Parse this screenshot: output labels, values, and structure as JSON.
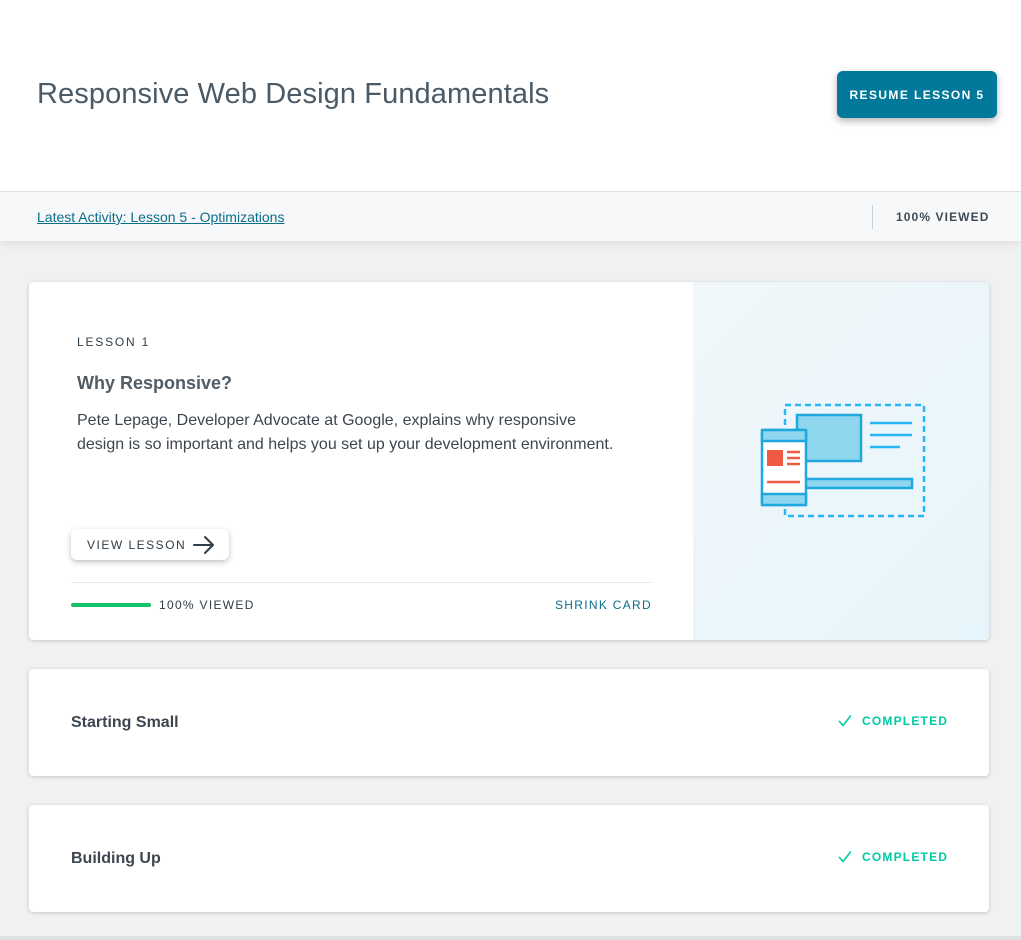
{
  "course": {
    "title": "Responsive Web Design Fundamentals",
    "resume_label": "RESUME LESSON 5"
  },
  "activity": {
    "latest_link": "Latest Activity: Lesson 5 - Optimizations",
    "viewed": "100% VIEWED"
  },
  "lessons": [
    {
      "kicker": "LESSON 1",
      "title": "Why Responsive?",
      "description": "Pete Lepage, Developer Advocate at Google, explains why responsive design is so important and helps you set up your development environment.",
      "view_label": "VIEW LESSON",
      "progress": 1.0,
      "progress_label": "100% VIEWED",
      "shrink_label": "SHRINK CARD",
      "illustration": "responsive-devices-illustration"
    },
    {
      "title": "Starting Small",
      "status": "COMPLETED",
      "status_icon": "check-icon"
    },
    {
      "title": "Building Up",
      "status": "COMPLETED",
      "status_icon": "check-icon"
    }
  ],
  "colors": {
    "accent": "#02789a",
    "link": "#0b6f8c",
    "progress": "#15c26b",
    "completed": "#02c9a4",
    "illustration_blue": "#29b6f6",
    "illustration_red": "#f15a42"
  }
}
